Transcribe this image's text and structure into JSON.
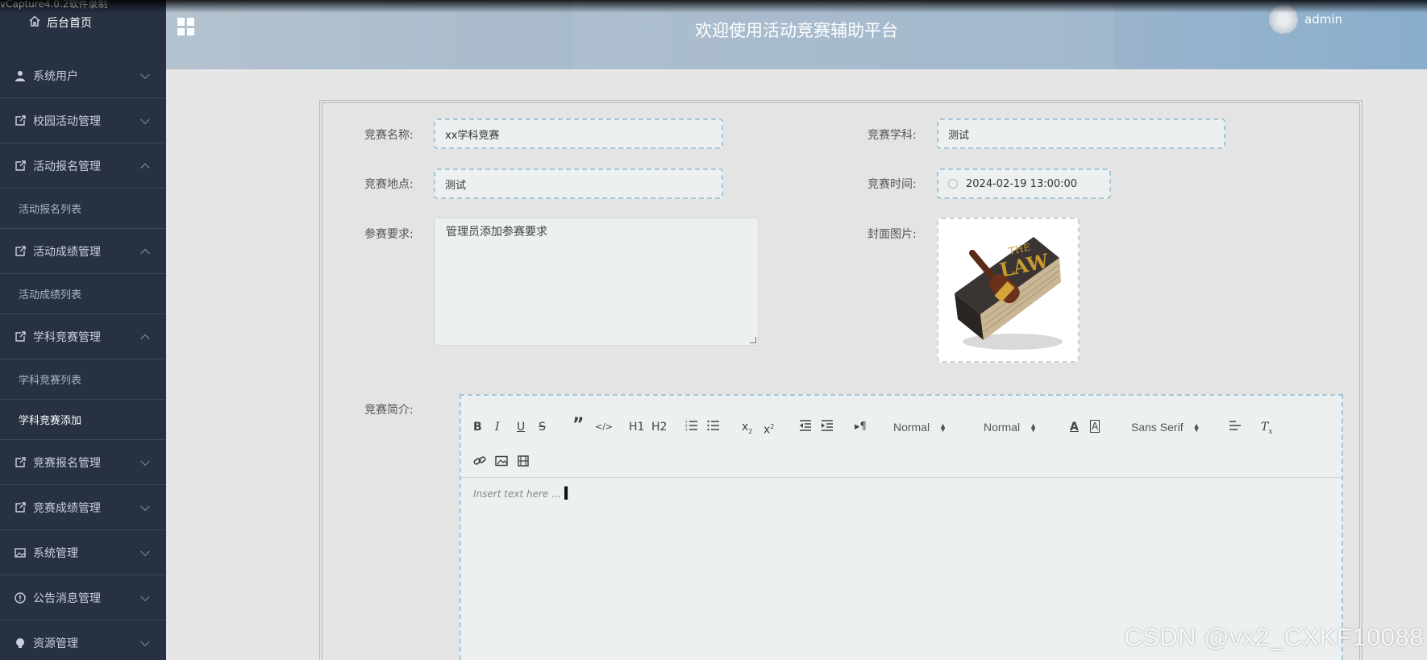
{
  "capture_label": "vCapture4.0.2软件录制",
  "sidebar": {
    "home": "后台首页",
    "items": [
      {
        "label": "系统用户",
        "expanded": false
      },
      {
        "label": "校园活动管理",
        "expanded": false
      },
      {
        "label": "活动报名管理",
        "expanded": true,
        "sub": [
          "活动报名列表"
        ]
      },
      {
        "label": "活动成绩管理",
        "expanded": true,
        "sub": [
          "活动成绩列表"
        ]
      },
      {
        "label": "学科竞赛管理",
        "expanded": true,
        "sub": [
          "学科竞赛列表",
          "学科竞赛添加"
        ]
      },
      {
        "label": "竞赛报名管理",
        "expanded": false
      },
      {
        "label": "竞赛成绩管理",
        "expanded": false
      },
      {
        "label": "系统管理",
        "expanded": false
      },
      {
        "label": "公告消息管理",
        "expanded": false
      },
      {
        "label": "资源管理",
        "expanded": false
      }
    ]
  },
  "header": {
    "title": "欢迎使用活动竞赛辅助平台",
    "username": "admin"
  },
  "form": {
    "name_label": "竞赛名称:",
    "name_value": "xx学科竞赛",
    "subject_label": "竞赛学科:",
    "subject_value": "测试",
    "location_label": "竞赛地点:",
    "location_value": "测试",
    "time_label": "竞赛时间:",
    "time_value": "2024-02-19 13:00:00",
    "requirement_label": "参赛要求:",
    "requirement_value": "管理员添加参赛要求",
    "cover_label": "封面图片:",
    "cover_text_top": "THE",
    "cover_text_main": "LAW",
    "intro_label": "竞赛简介:"
  },
  "editor": {
    "bold": "B",
    "italic": "I",
    "underline": "U",
    "strike": "S",
    "quote": "”",
    "code": "</>",
    "h1": "H1",
    "h2": "H2",
    "sub": "x",
    "sub_mark": "2",
    "sup": "x",
    "sup_mark": "2",
    "size_select": "Normal",
    "header_select": "Normal",
    "font_select": "Sans Serif",
    "placeholder": "Insert text here ..."
  },
  "watermark": "CSDN @vx2_CXKF10088"
}
